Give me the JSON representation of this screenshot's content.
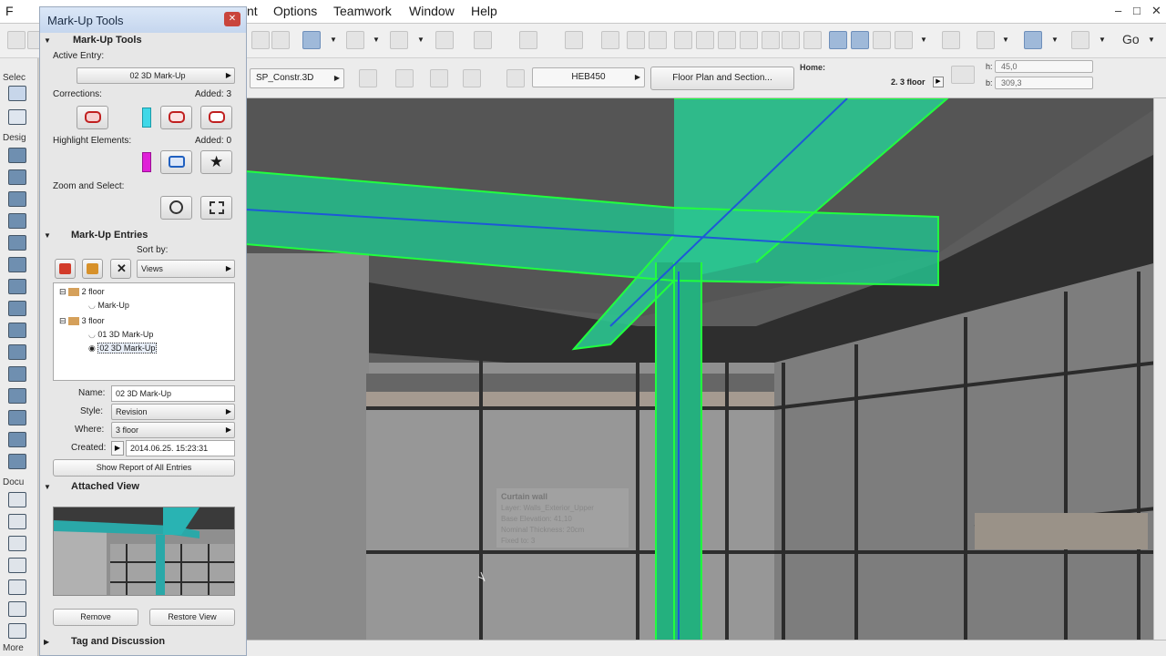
{
  "menubar": {
    "app_letter": "F",
    "items": [
      "nt",
      "Options",
      "Teamwork",
      "Window",
      "Help"
    ],
    "window_controls": [
      "–",
      "□",
      "✕"
    ]
  },
  "toolbar": {
    "go_label": "Go"
  },
  "info_box": {
    "layer_value": "SP_Constr.3D",
    "profile_value": "HEB450",
    "view_button": "Floor Plan and Section...",
    "home_label": "Home:",
    "story_value": "2. 3 floor",
    "h_label": "h:",
    "h_value": "45,0",
    "b_label": "b:",
    "b_value": "309,3"
  },
  "toolbox": {
    "labels": [
      "Selec",
      "Desig",
      "Docu",
      "More"
    ]
  },
  "panel": {
    "title": "Mark-Up Tools",
    "section_tools": "Mark-Up Tools",
    "active_entry_label": "Active Entry:",
    "active_entry_value": "02 3D Mark-Up",
    "corrections_label": "Corrections:",
    "corrections_added": "Added: 3",
    "corrections_color": "#3fd8e8",
    "highlight_label": "Highlight Elements:",
    "highlight_added": "Added: 0",
    "highlight_color": "#e020d8",
    "zoom_label": "Zoom and Select:",
    "section_entries": "Mark-Up Entries",
    "sort_by_label": "Sort by:",
    "sort_by_value": "Views",
    "tree": [
      {
        "label": "2 floor",
        "kind": "folder"
      },
      {
        "label": "Mark-Up",
        "kind": "entry"
      },
      {
        "label": "3 floor",
        "kind": "folder"
      },
      {
        "label": "01 3D Mark-Up",
        "kind": "entry"
      },
      {
        "label": "02 3D Mark-Up",
        "kind": "entry-selected"
      }
    ],
    "name_label": "Name:",
    "name_value": "02 3D Mark-Up",
    "style_label": "Style:",
    "style_value": "Revision",
    "where_label": "Where:",
    "where_value": "3 floor",
    "created_label": "Created:",
    "created_value": "2014.06.25. 15:23:31",
    "report_button": "Show Report of All Entries",
    "section_view": "Attached View",
    "remove_button": "Remove",
    "restore_button": "Restore View",
    "section_tag": "Tag and Discussion"
  },
  "tooltip": {
    "title": "Curtain wall",
    "lines": [
      "Layer: Walls_Exterior_Upper",
      "Base Elevation: 41,10",
      "Nominal Thickness: 20cm",
      "Fixed to: 3"
    ]
  }
}
